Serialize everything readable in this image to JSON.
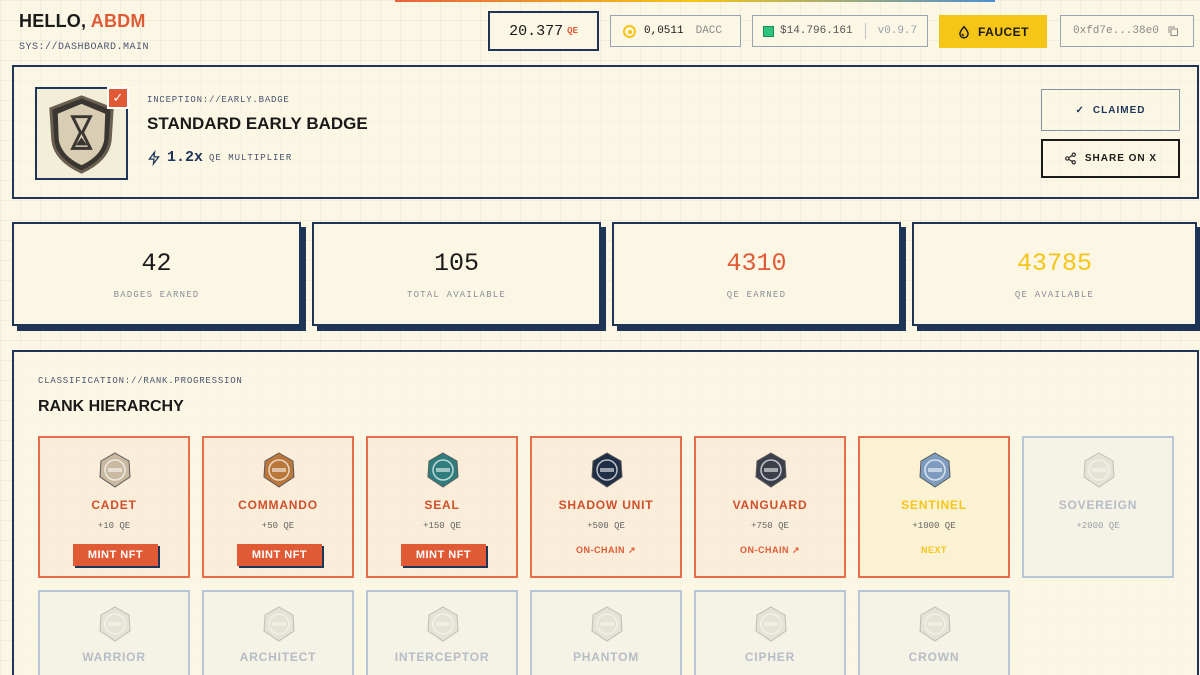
{
  "header": {
    "greeting": "HELLO,",
    "username": "ABDM",
    "sys_path": "SYS://DASHBOARD.MAIN",
    "qe_balance": "20.377",
    "qe_unit": "QE",
    "dacc_value": "0,0511",
    "dacc_unit": "DACC",
    "price": "$14.796.161",
    "version": "v0.9.7",
    "faucet_label": "FAUCET",
    "wallet_address": "0xfd7e...38e0",
    "icons": [
      "coin-icon",
      "status-square-icon",
      "droplet-icon",
      "copy-icon"
    ]
  },
  "badge": {
    "inception": "INCEPTION://EARLY.BADGE",
    "title": "STANDARD EARLY BADGE",
    "multiplier": "1.2x",
    "multiplier_label": "QE MULTIPLIER",
    "claimed_label": "CLAIMED",
    "share_label": "SHARE ON X",
    "icons": [
      "hourglass-shield-icon",
      "check-icon",
      "lightning-icon",
      "share-icon"
    ]
  },
  "stats": [
    {
      "value": "42",
      "label": "BADGES EARNED",
      "color": "#1a1a1a"
    },
    {
      "value": "105",
      "label": "TOTAL AVAILABLE",
      "color": "#1a1a1a"
    },
    {
      "value": "4310",
      "label": "QE EARNED",
      "color": "#e05a35"
    },
    {
      "value": "43785",
      "label": "QE AVAILABLE",
      "color": "#f5c518"
    }
  ],
  "rank": {
    "classification": "CLASSIFICATION://RANK.PROGRESSION",
    "title": "RANK HIERARCHY",
    "mint_label": "MINT NFT",
    "onchain_label": "ON-CHAIN",
    "next_label": "NEXT",
    "tiers": [
      {
        "name": "CADET",
        "points": "+10 QE",
        "state": "mint",
        "medal_color": "#c9b9a0"
      },
      {
        "name": "COMMANDO",
        "points": "+50 QE",
        "state": "mint",
        "medal_color": "#b9773a"
      },
      {
        "name": "SEAL",
        "points": "+150 QE",
        "state": "mint",
        "medal_color": "#2f7d7d"
      },
      {
        "name": "SHADOW UNIT",
        "points": "+500 QE",
        "state": "onchain",
        "medal_color": "#1f2d45"
      },
      {
        "name": "VANGUARD",
        "points": "+750 QE",
        "state": "onchain",
        "medal_color": "#3a3f4a"
      },
      {
        "name": "SENTINEL",
        "points": "+1000 QE",
        "state": "next",
        "medal_color": "#7e9cc0"
      },
      {
        "name": "SOVEREIGN",
        "points": "+2000 QE",
        "state": "locked",
        "medal_color": "#c8c8bc"
      },
      {
        "name": "WARRIOR",
        "state": "locked",
        "medal_color": "#c8c8bc"
      },
      {
        "name": "ARCHITECT",
        "state": "locked",
        "medal_color": "#c8c8bc"
      },
      {
        "name": "INTERCEPTOR",
        "state": "locked",
        "medal_color": "#c8c8bc"
      },
      {
        "name": "PHANTOM",
        "state": "locked",
        "medal_color": "#c8c8bc"
      },
      {
        "name": "CIPHER",
        "state": "locked",
        "medal_color": "#c8c8bc"
      },
      {
        "name": "CROWN",
        "state": "locked",
        "medal_color": "#c8c8bc"
      }
    ]
  }
}
